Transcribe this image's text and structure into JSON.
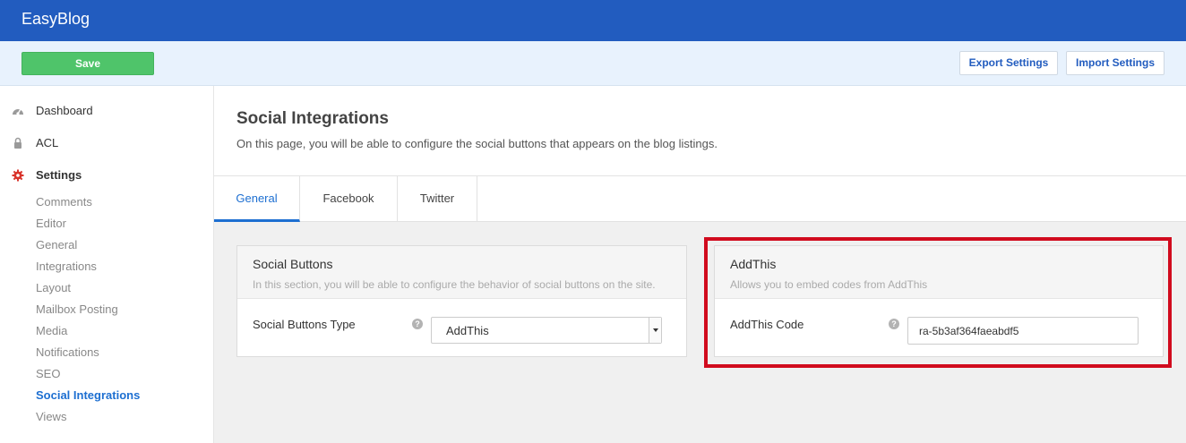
{
  "app": {
    "brand": "EasyBlog"
  },
  "toolbar": {
    "save_label": "Save",
    "export_label": "Export Settings",
    "import_label": "Import Settings"
  },
  "sidebar": {
    "main": [
      {
        "label": "Dashboard",
        "icon": "dashboard-icon"
      },
      {
        "label": "ACL",
        "icon": "lock-icon"
      },
      {
        "label": "Settings",
        "icon": "gear-icon"
      }
    ],
    "sub": [
      {
        "label": "Comments"
      },
      {
        "label": "Editor"
      },
      {
        "label": "General"
      },
      {
        "label": "Integrations"
      },
      {
        "label": "Layout"
      },
      {
        "label": "Mailbox Posting"
      },
      {
        "label": "Media"
      },
      {
        "label": "Notifications"
      },
      {
        "label": "SEO"
      },
      {
        "label": "Social Integrations",
        "active": true
      },
      {
        "label": "Views"
      }
    ]
  },
  "page": {
    "title": "Social Integrations",
    "description": "On this page, you will be able to configure the social buttons that appears on the blog listings."
  },
  "tabs": [
    {
      "label": "General",
      "active": true
    },
    {
      "label": "Facebook"
    },
    {
      "label": "Twitter"
    }
  ],
  "panels": {
    "social_buttons": {
      "title": "Social Buttons",
      "description": "In this section, you will be able to configure the behavior of social buttons on the site.",
      "field_label": "Social Buttons Type",
      "field_value": "AddThis"
    },
    "addthis": {
      "title": "AddThis",
      "description": "Allows you to embed codes from AddThis",
      "field_label": "AddThis Code",
      "field_value": "ra-5b3af364faeabdf5"
    }
  },
  "colors": {
    "topbar": "#225cbf",
    "save": "#4fc46a",
    "accent": "#1d6fd1",
    "gear": "#d9342b",
    "highlight": "#d10b1e"
  }
}
